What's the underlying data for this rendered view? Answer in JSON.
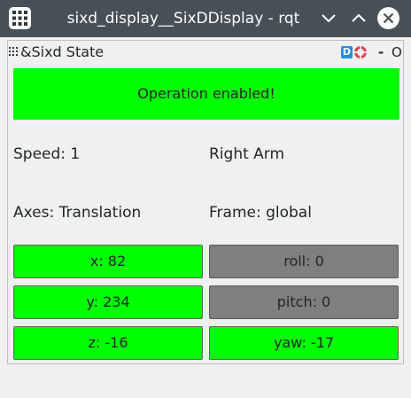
{
  "window": {
    "title": "sixd_display__SixDDisplay - rqt",
    "icons": {
      "app": "grid-apps-icon",
      "minimize": "chevron-down-icon",
      "maximize": "chevron-up-icon",
      "close": "close-icon"
    }
  },
  "plugin": {
    "title": "&Sixd State",
    "help_glyph": "D",
    "minimize_label": "-",
    "close_label": "O"
  },
  "status": {
    "message": "Operation enabled!",
    "color": "#00ff00"
  },
  "info": {
    "speed": "Speed: 1",
    "arm": "Right Arm",
    "axes": "Axes: Translation",
    "frame": "Frame: global"
  },
  "axes": {
    "x": {
      "label": "x: 82",
      "active": true
    },
    "y": {
      "label": "y: 234",
      "active": true
    },
    "z": {
      "label": "z: -16",
      "active": true
    },
    "roll": {
      "label": "roll: 0",
      "active": false
    },
    "pitch": {
      "label": "pitch: 0",
      "active": false
    },
    "yaw": {
      "label": "yaw: -17",
      "active": true
    }
  },
  "colors": {
    "active": "#00ff00",
    "inactive": "#7f7f7f",
    "titlebar": "#475057"
  }
}
